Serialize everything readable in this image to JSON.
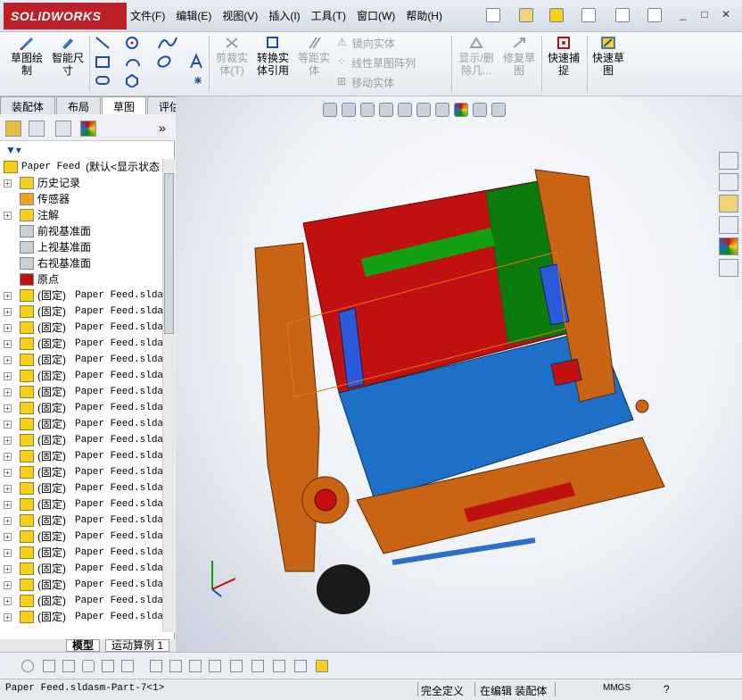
{
  "app": {
    "brand": "SOLIDWORKS"
  },
  "menu": [
    "文件(F)",
    "编辑(E)",
    "视图(V)",
    "插入(I)",
    "工具(T)",
    "窗口(W)",
    "帮助(H)"
  ],
  "commands": {
    "sketch": "草图绘\n制",
    "smart_dim": "智能尺\n寸",
    "trim": "剪裁实\n体(T)",
    "convert": "转换实\n体引用",
    "offset": "等距实\n体",
    "mirror": "镜向实体",
    "linear_pattern": "线性草图阵列",
    "move": "移动实体",
    "show_delete": "显示/删\n除几...",
    "repair": "修复草\n图",
    "quick_snap": "快速捕\n捉",
    "rapid_sketch": "快速草\n图"
  },
  "tabs": [
    "装配体",
    "布局",
    "草图",
    "评估"
  ],
  "active_tab": "草图",
  "tree": {
    "root_name": "Paper Feed",
    "root_config": "(默认<显示状态",
    "fixed_items": [
      "历史记录",
      "传感器",
      "注解",
      "前视基准面",
      "上视基准面",
      "右视基准面",
      "原点"
    ],
    "part_prefix": "(固定)",
    "part_name": "Paper Feed.sldas",
    "part_count": 21
  },
  "bottom_tabs": [
    "模型",
    "运动算例 1"
  ],
  "status": {
    "doc": "Paper Feed.sldasm-Part-7<1>",
    "state": "完全定义",
    "mode": "在编辑 装配体",
    "units": "MMGS"
  },
  "icons": [
    "solidworks-logo",
    "sketch-icon",
    "smart-dimension-icon",
    "line-icon",
    "circle-icon",
    "spline-icon",
    "rectangle-icon",
    "arc-icon",
    "trim-icon",
    "convert-icon",
    "offset-icon",
    "mirror-icon",
    "pattern-icon",
    "move-icon",
    "display-delete-icon",
    "repair-icon",
    "snap-icon",
    "rapid-sketch-icon"
  ],
  "colors": {
    "brand": "#bd2026",
    "frame": "#c86414",
    "panel_red": "#c01010",
    "panel_green": "#0a8a0a",
    "panel_blue": "#1e6fc8"
  }
}
